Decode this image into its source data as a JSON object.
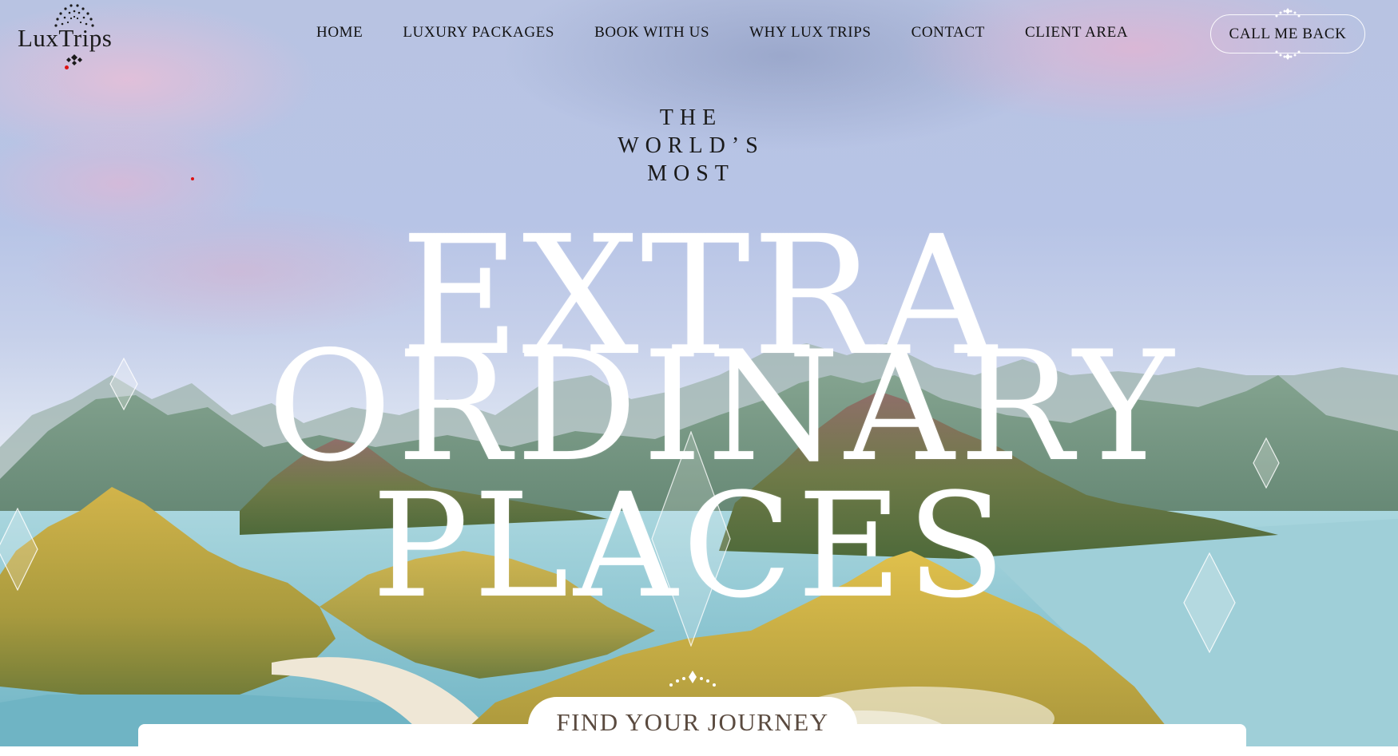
{
  "nav": {
    "logo_text": "LuxTrips",
    "items": [
      {
        "label": "HOME"
      },
      {
        "label": "LUXURY PACKAGES"
      },
      {
        "label": "BOOK WITH US"
      },
      {
        "label": "WHY LUX TRIPS"
      },
      {
        "label": "CONTACT"
      },
      {
        "label": "CLIENT AREA"
      }
    ],
    "cta_label": "CALL ME BACK"
  },
  "hero": {
    "tagline": [
      "THE",
      "WORLD’S",
      "MOST"
    ],
    "headline": [
      "EXTRA",
      "ORDINARY",
      "PLACES"
    ],
    "journey_label": "FIND YOUR JOURNEY"
  },
  "colors": {
    "text_dark": "#111111",
    "headline": "#ffffff",
    "accent_red": "#dd1111",
    "journey_text": "#5a4a3f"
  },
  "icons": [
    "logo-mark-icon",
    "diamond-ornament-icon",
    "dotted-arc-ornament-icon"
  ]
}
